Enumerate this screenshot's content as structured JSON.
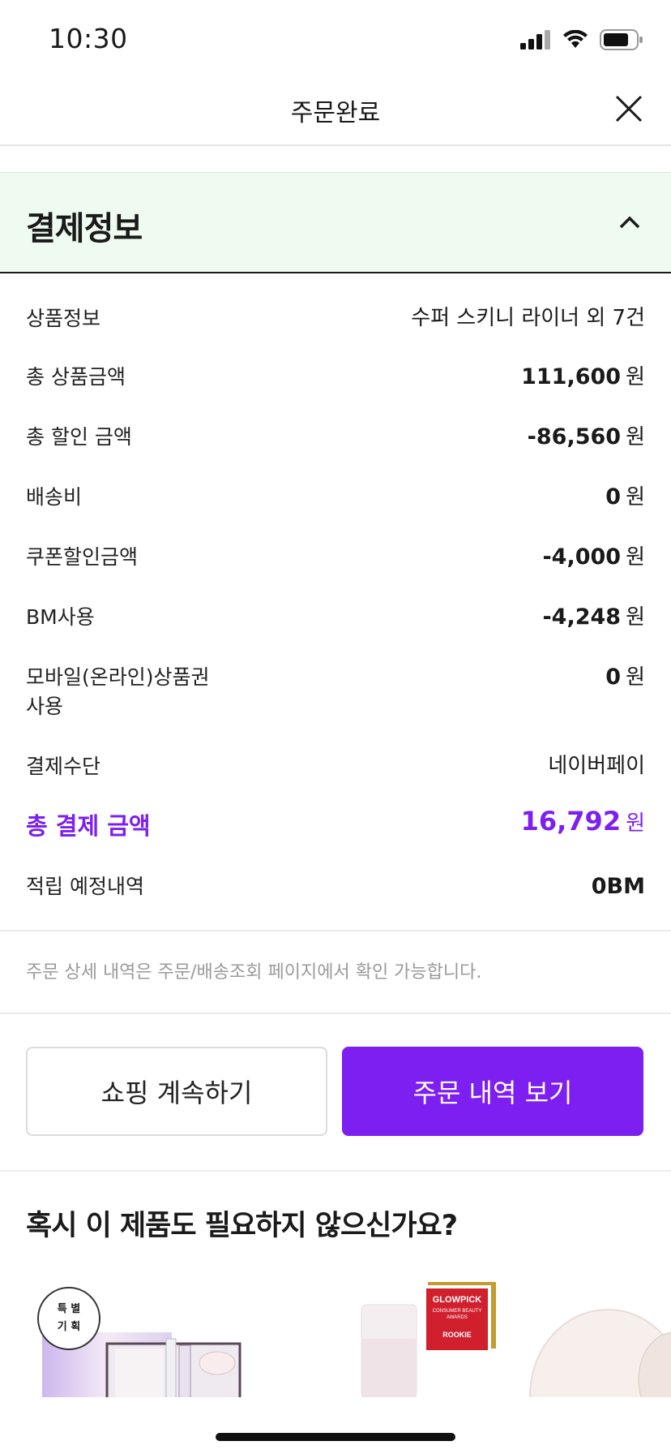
{
  "status": {
    "time": "10:30"
  },
  "nav": {
    "title": "주문완료"
  },
  "section": {
    "title": "결제정보"
  },
  "rows": [
    {
      "label": "상품정보",
      "value": "수퍼 스키니 라이너 외 7건",
      "unit": ""
    },
    {
      "label": "총 상품금액",
      "value": "111,600",
      "unit": "원"
    },
    {
      "label": "총 할인 금액",
      "value": "-86,560",
      "unit": "원"
    },
    {
      "label": "배송비",
      "value": "0",
      "unit": "원"
    },
    {
      "label": "쿠폰할인금액",
      "value": "-4,000",
      "unit": "원"
    },
    {
      "label": "BM사용",
      "value": "-4,248",
      "unit": "원"
    },
    {
      "label_line1": "모바일(온라인)상품권",
      "label_line2": "사용",
      "value": "0",
      "unit": "원"
    },
    {
      "label": "결제수단",
      "value": "네이버페이",
      "unit": ""
    },
    {
      "label": "총 결제 금액",
      "value": "16,792",
      "unit": "원"
    },
    {
      "label": "적립 예정내역",
      "value": "0BM",
      "unit": ""
    }
  ],
  "notice": "주문 상세 내역은 주문/배송조회 페이지에서 확인 가능합니다.",
  "buttons": {
    "continue_shopping": "쇼핑 계속하기",
    "view_order": "주문 내역 보기"
  },
  "recommendation": {
    "title": "혹시 이 제품도 필요하지 않으신가요?",
    "badge_text": [
      "특 별",
      "기 획"
    ],
    "award_text": [
      "GLOWPICK",
      "CONSUMER BEAUTY AWARDS",
      "ROOKIE"
    ]
  },
  "colors": {
    "accent": "#7c1ff0",
    "section_bg": "#effbf1"
  }
}
